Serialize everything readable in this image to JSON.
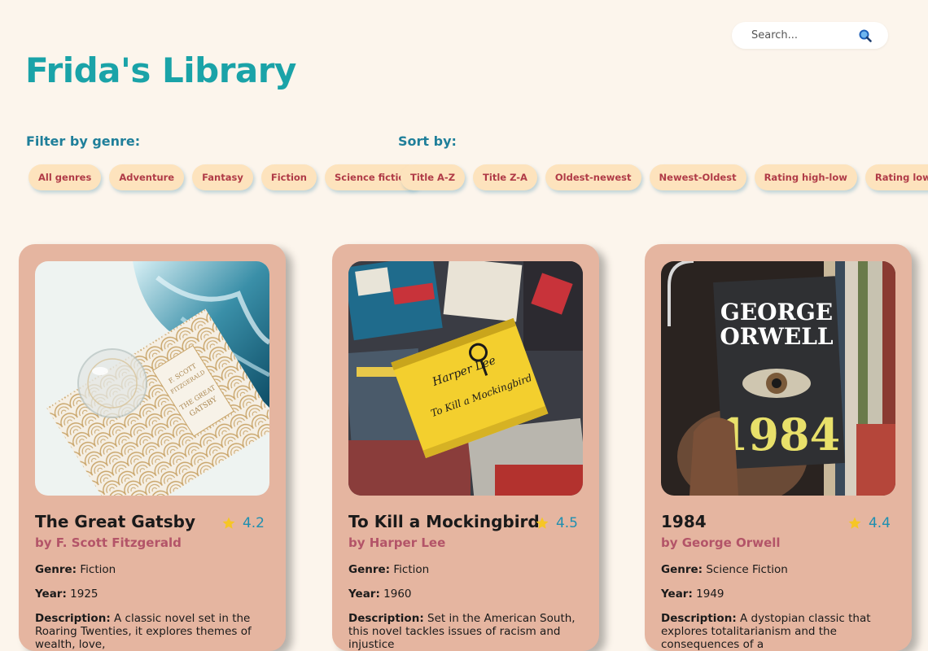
{
  "search": {
    "placeholder": "Search..."
  },
  "title": "Frida's Library",
  "filter": {
    "label": "Filter by genre:",
    "options": [
      "All genres",
      "Adventure",
      "Fantasy",
      "Fiction",
      "Science fiction"
    ]
  },
  "sort": {
    "label": "Sort by:",
    "options": [
      "Title A-Z",
      "Title Z-A",
      "Oldest-newest",
      "Newest-Oldest",
      "Rating high-low",
      "Rating low-high"
    ]
  },
  "labels": {
    "genre": "Genre:",
    "year": "Year:",
    "description": "Description:"
  },
  "books": [
    {
      "title": "The Great Gatsby",
      "author": "by F. Scott Fitzgerald",
      "rating": "4.2",
      "genre": "Fiction",
      "year": "1925",
      "description": "A classic novel set in the Roaring Twenties, it explores themes of wealth, love,",
      "cover_text": [
        "F. SCOTT",
        "FITZGERALD",
        "THE GREAT",
        "GATSBY"
      ]
    },
    {
      "title": "To Kill a Mockingbird",
      "author": "by Harper Lee",
      "rating": "4.5",
      "genre": "Fiction",
      "year": "1960",
      "description": "Set in the American South, this novel tackles issues of racism and injustice",
      "cover_text": [
        "Harper Lee",
        "To Kill a Mockingbird"
      ]
    },
    {
      "title": "1984",
      "author": "by George Orwell",
      "rating": "4.4",
      "genre": "Science Fiction",
      "year": "1949",
      "description": "A dystopian classic that explores totalitarianism and the consequences of a",
      "cover_text": [
        "GEORGE",
        "ORWELL",
        "1984"
      ]
    }
  ],
  "colors": {
    "background": "#fcf5ec",
    "title": "#1aa3a8",
    "section_label": "#1f7f9a",
    "chip_bg": "#fde3bd",
    "chip_text": "#b03b47",
    "card_bg": "#e5b5a0",
    "author": "#b35468",
    "rating": "#1f8fb0",
    "star": "#f6c625"
  },
  "icons": {
    "search": "search-icon",
    "star": "star-icon"
  }
}
